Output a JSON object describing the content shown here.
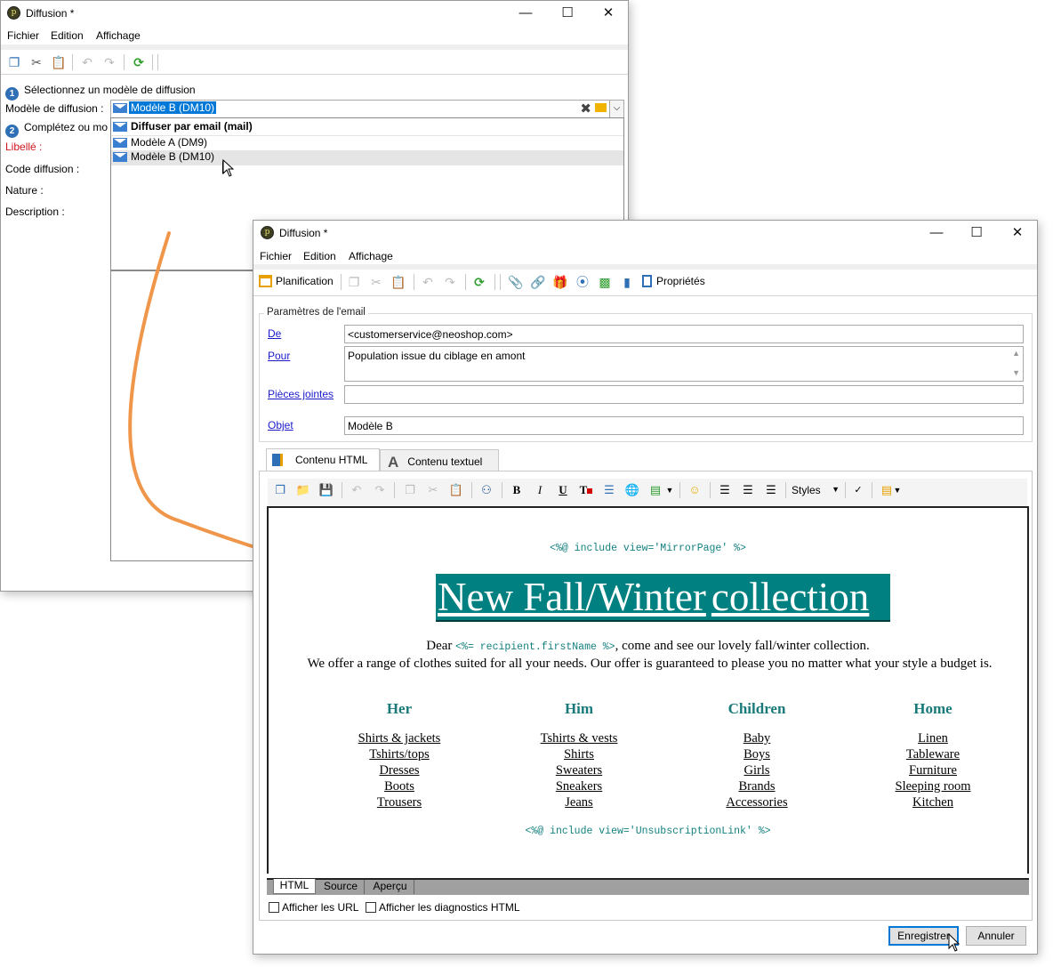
{
  "back_window": {
    "title": "Diffusion *",
    "menu": [
      "Fichier",
      "Edition",
      "Affichage"
    ],
    "step1": "Sélectionnez un modèle de diffusion",
    "template_label": "Modèle de diffusion :",
    "template_value": "Modèle B (DM10)",
    "step2": "Complétez ou mo",
    "fields": {
      "libelle": "Libellé :",
      "code": "Code diffusion :",
      "nature": "Nature :",
      "description": "Description :"
    },
    "dropdown_items": [
      "Diffuser par email (mail)",
      "Modèle A (DM9)",
      "Modèle B (DM10)"
    ]
  },
  "front_window": {
    "title": "Diffusion *",
    "menu": [
      "Fichier",
      "Edition",
      "Affichage"
    ],
    "toolbar": {
      "planification": "Planification",
      "proprietes": "Propriétés"
    },
    "email_params": {
      "section": "Paramètres de l'email",
      "de_label": "De",
      "de_value": "<customerservice@neoshop.com>",
      "pour_label": "Pour",
      "pour_value": "Population issue du ciblage en amont",
      "pj_label": "Pièces jointes",
      "pj_value": "",
      "objet_label": "Objet",
      "objet_value": "Modèle B"
    },
    "tabs": [
      "Contenu HTML",
      "Contenu textuel"
    ],
    "styles_label": "Styles",
    "content": {
      "mirror_code": "<%@ include view='MirrorPage' %>",
      "headline_1": "New Fall/Winter",
      "headline_2": "collection",
      "dear": "Dear",
      "name_code": "<%= recipient.firstName %>",
      "dear_rest": ", come and see our lovely fall/winter collection.",
      "offer": "We offer a range of clothes suited for all your needs. Our offer is guaranteed to please you no matter what your style a budget is.",
      "categories": [
        {
          "title": "Her",
          "items": [
            "Shirts & jackets",
            "Tshirts/tops",
            "Dresses",
            "Boots",
            "Trousers"
          ]
        },
        {
          "title": "Him",
          "items": [
            "Tshirts & vests",
            "Shirts",
            "Sweaters",
            "Sneakers",
            "Jeans"
          ]
        },
        {
          "title": "Children",
          "items": [
            "Baby",
            "Boys",
            "Girls",
            "Brands",
            "Accessories"
          ]
        },
        {
          "title": "Home",
          "items": [
            "Linen",
            "Tableware",
            "Furniture",
            "Sleeping room",
            "Kitchen"
          ]
        }
      ],
      "unsub_code": "<%@ include view='UnsubscriptionLink' %>"
    },
    "view_tabs": [
      "HTML",
      "Source",
      "Aperçu"
    ],
    "checkboxes": [
      "Afficher les URL",
      "Afficher les diagnostics HTML"
    ],
    "buttons": {
      "save": "Enregistrer",
      "cancel": "Annuler"
    }
  },
  "colors": {
    "accent_teal": "#008080",
    "arrow_orange": "#f0964a",
    "selection_blue": "#0078d7"
  }
}
